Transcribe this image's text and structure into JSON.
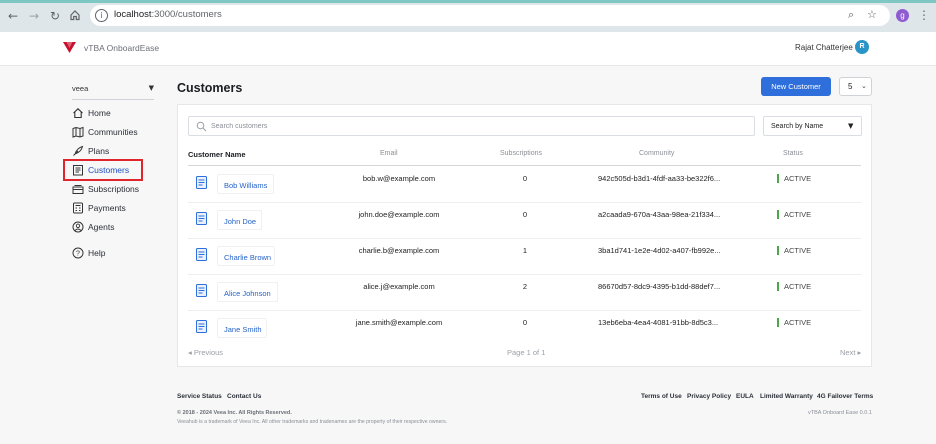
{
  "browser": {
    "url_host": "localhost",
    "url_path": ":3000/customers",
    "profile_initial": "g"
  },
  "header": {
    "brand": "vTBA OnboardEase",
    "user_name": "Rajat Chatterjee",
    "user_initial": "R"
  },
  "sidebar": {
    "org": "veea",
    "items": [
      {
        "label": "Home",
        "icon": "home-icon"
      },
      {
        "label": "Communities",
        "icon": "communities-icon"
      },
      {
        "label": "Plans",
        "icon": "plans-icon"
      },
      {
        "label": "Customers",
        "icon": "customers-icon"
      },
      {
        "label": "Subscriptions",
        "icon": "subscriptions-icon"
      },
      {
        "label": "Payments",
        "icon": "payments-icon"
      },
      {
        "label": "Agents",
        "icon": "agents-icon"
      },
      {
        "label": "Help",
        "icon": "help-icon"
      }
    ]
  },
  "main": {
    "title": "Customers",
    "new_button": "New Customer",
    "page_size": "5",
    "search_placeholder": "Search customers",
    "search_by": "Search by Name",
    "columns": [
      "Customer Name",
      "Email",
      "Subscriptions",
      "Community",
      "Status"
    ],
    "rows": [
      {
        "name": "Bob Williams",
        "email": "bob.w@example.com",
        "subscriptions": "0",
        "community": "942c505d-b3d1-4fdf-aa33-be322f6...",
        "status": "ACTIVE"
      },
      {
        "name": "John Doe",
        "email": "john.doe@example.com",
        "subscriptions": "0",
        "community": "a2caada9-670a-43aa-98ea-21f334...",
        "status": "ACTIVE"
      },
      {
        "name": "Charlie Brown",
        "email": "charlie.b@example.com",
        "subscriptions": "1",
        "community": "3ba1d741-1e2e-4d02-a407-fb992e...",
        "status": "ACTIVE"
      },
      {
        "name": "Alice Johnson",
        "email": "alice.j@example.com",
        "subscriptions": "2",
        "community": "86670d57-8dc9-4395-b1dd-88def7...",
        "status": "ACTIVE"
      },
      {
        "name": "Jane Smith",
        "email": "jane.smith@example.com",
        "subscriptions": "0",
        "community": "13eb6eba-4ea4-4081-91bb-8d5c3...",
        "status": "ACTIVE"
      }
    ],
    "pagination": {
      "prev": "Previous",
      "info": "Page 1 of 1",
      "next": "Next"
    }
  },
  "footer": {
    "left_links": [
      "Service Status",
      "Contact Us"
    ],
    "right_links": [
      "Terms of Use",
      "Privacy Policy",
      "EULA",
      "Limited Warranty",
      "4G Failover Terms"
    ],
    "copyright": "© 2018 - 2024 Veea Inc. All Rights Reserved.",
    "trademark": "Veeahub is a trademark of Veea Inc. All other trademarks and tradenames are the property of their respective owners.",
    "version": "vTBA Onboard Ease 0.0.1"
  },
  "colors": {
    "accent": "#2f6fdb",
    "active_outline": "#e0262d",
    "status_active": "#4aa84a",
    "logo": "#c8102e"
  }
}
